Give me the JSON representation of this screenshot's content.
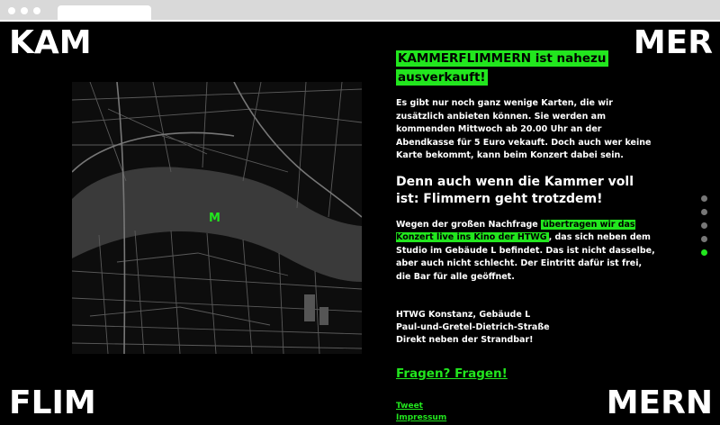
{
  "corners": {
    "top_left": "KAM",
    "top_right": "MER",
    "bottom_left": "FLIM",
    "bottom_right": "MERN"
  },
  "map": {
    "marker": "M"
  },
  "content": {
    "headline": "KAMMERFLIMMERN ist nahezu ausverkauft!",
    "intro": "Es gibt nur noch ganz wenige Karten, die wir zusätzlich anbieten können. Sie werden am kommenden Mittwoch ab 20.00 Uhr an der Abendkasse für 5 Euro vekauft. Doch auch wer keine Karte bekommt, kann beim Konzert dabei sein.",
    "subhead": "Denn auch wenn die Kammer voll ist: Flimmern geht trotzdem!",
    "para_before": "Wegen der großen Nachfrage ",
    "para_mark": "übertragen wir das Konzert live ins Kino der HTWG",
    "para_after": ", das sich neben dem Studio im Gebäude L befindet. Das ist nicht dasselbe, aber auch nicht schlecht. Der Eintritt dafür ist frei, die Bar für alle geöffnet.",
    "address": [
      "HTWG Konstanz, Gebäude L",
      "Paul-und-Gretel-Dietrich-Straße",
      "Direkt neben der Strandbar!"
    ],
    "fragen": "Fragen? Fragen!",
    "links": [
      "Tweet",
      "Impressum"
    ]
  },
  "nav": {
    "dot_count": 5,
    "active_index": 4
  },
  "colors": {
    "accent": "#22e61e",
    "background": "#000000"
  }
}
